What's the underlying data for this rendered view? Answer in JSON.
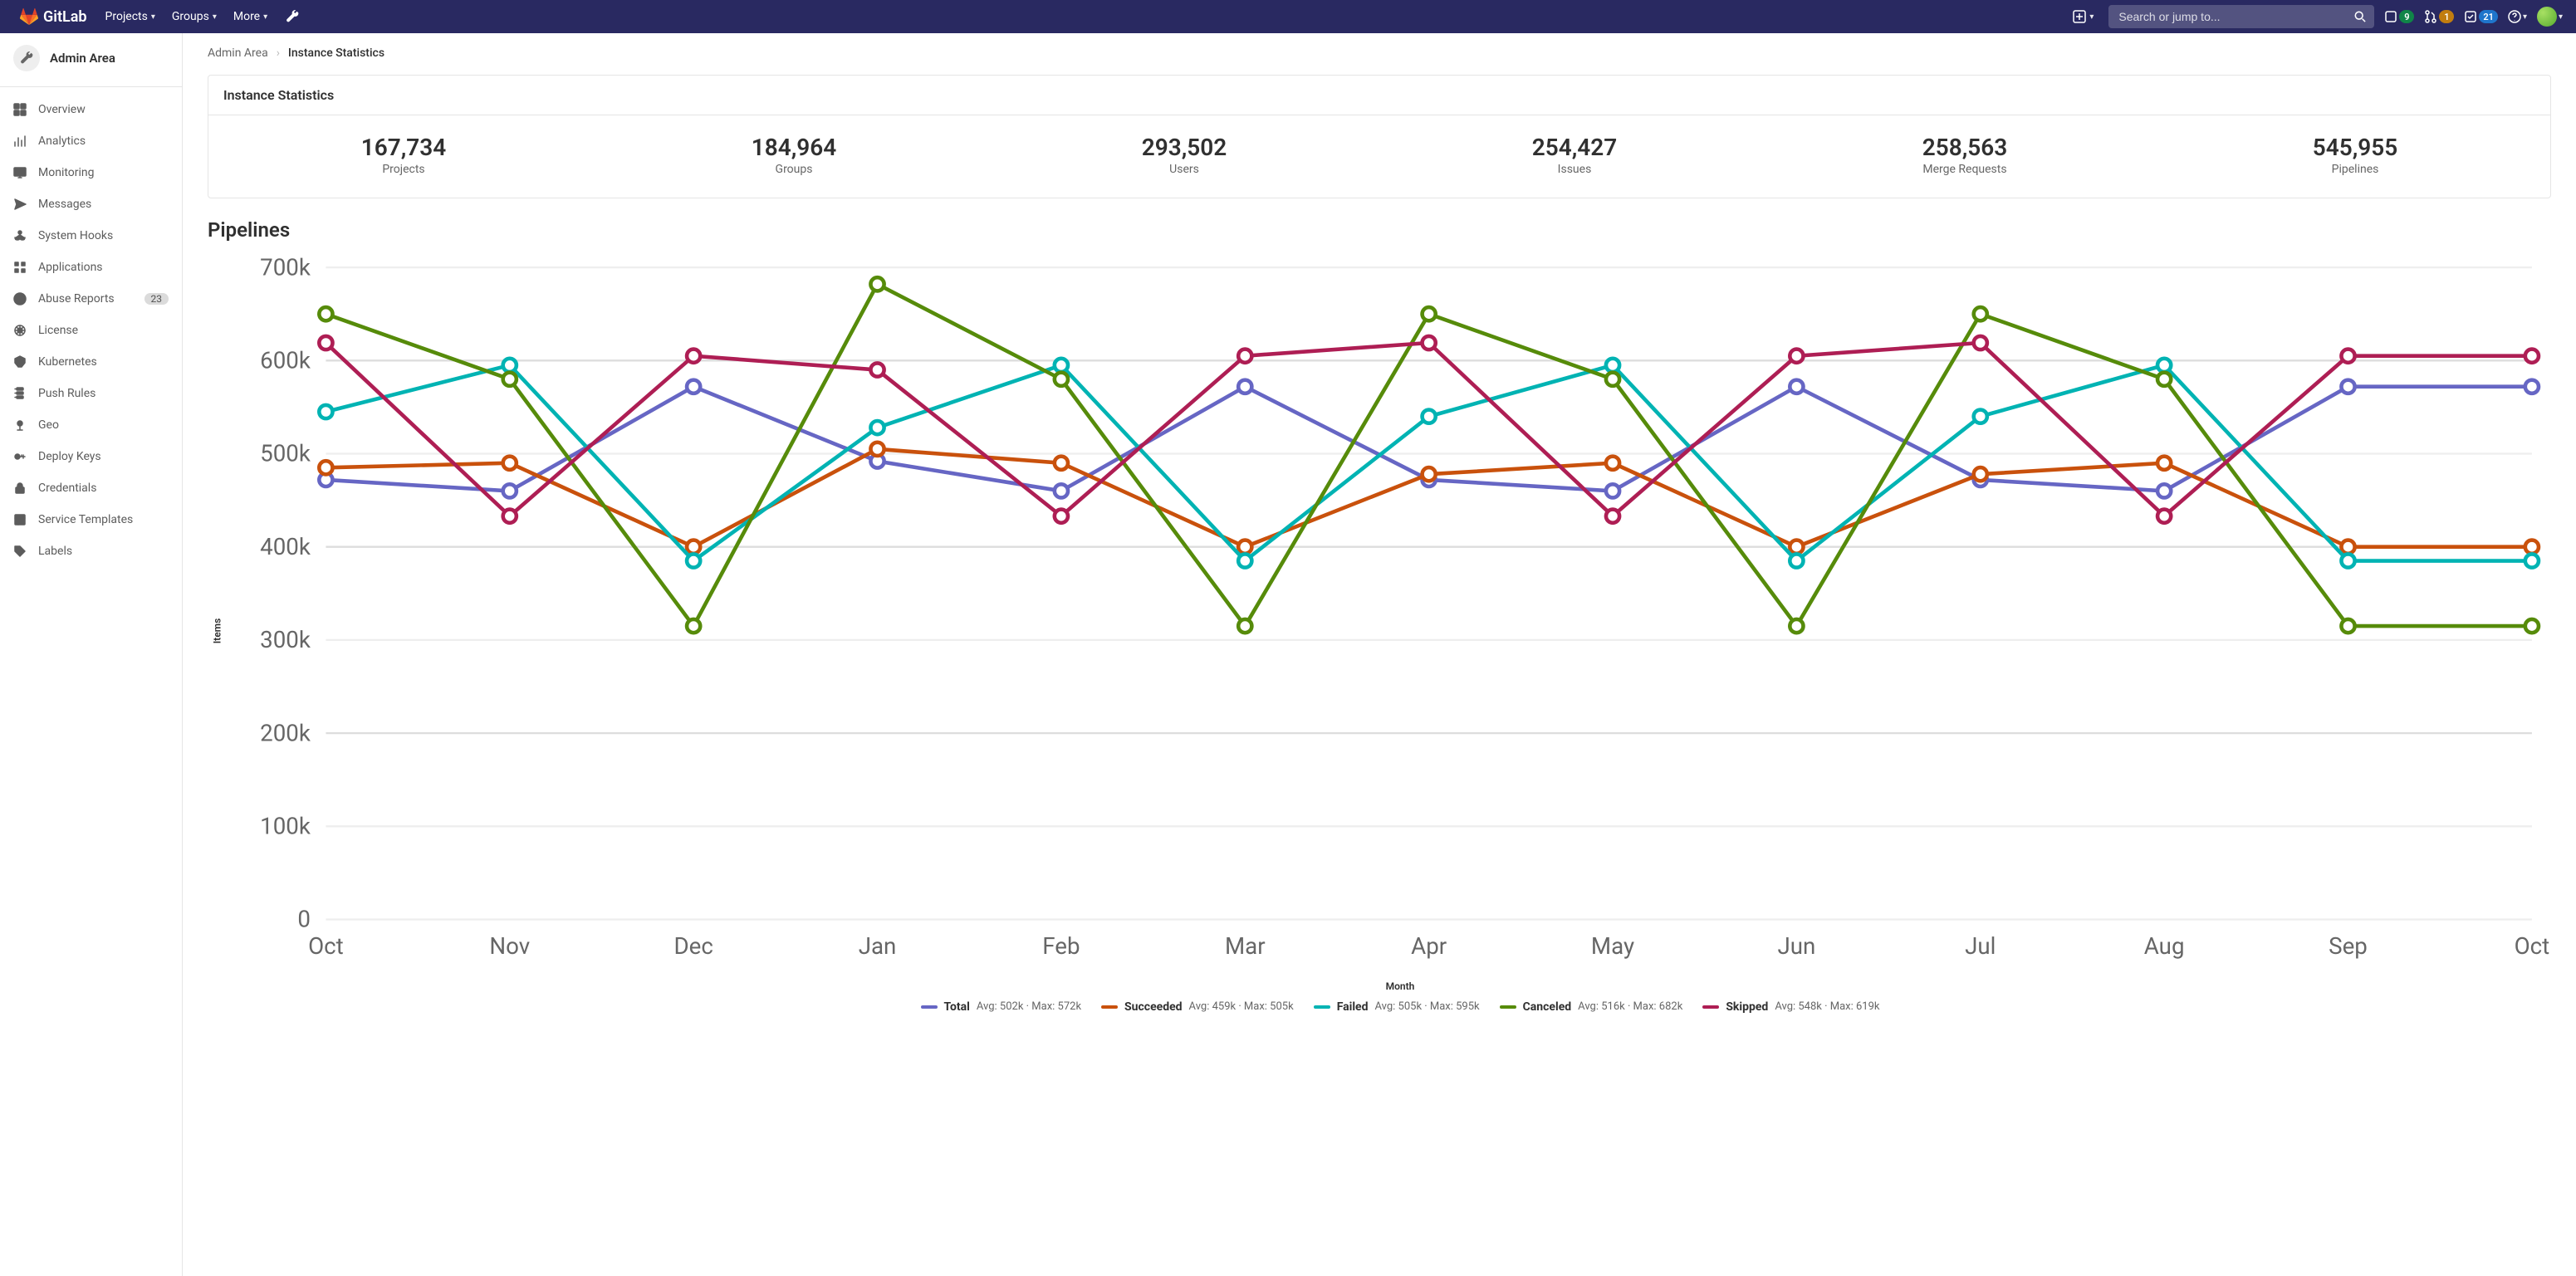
{
  "topnav": {
    "logo_text": "GitLab",
    "items": [
      {
        "label": "Projects",
        "has_caret": true
      },
      {
        "label": "Groups",
        "has_caret": true
      },
      {
        "label": "More",
        "has_caret": true
      }
    ],
    "search_placeholder": "Search or jump to...",
    "badges": {
      "issues": "9",
      "mrs": "1",
      "todos": "21"
    }
  },
  "sidebar": {
    "title": "Admin Area",
    "items": [
      {
        "icon": "overview",
        "label": "Overview"
      },
      {
        "icon": "analytics",
        "label": "Analytics"
      },
      {
        "icon": "monitoring",
        "label": "Monitoring"
      },
      {
        "icon": "messages",
        "label": "Messages"
      },
      {
        "icon": "hooks",
        "label": "System Hooks"
      },
      {
        "icon": "apps",
        "label": "Applications"
      },
      {
        "icon": "abuse",
        "label": "Abuse Reports",
        "count": "23"
      },
      {
        "icon": "license",
        "label": "License"
      },
      {
        "icon": "k8s",
        "label": "Kubernetes"
      },
      {
        "icon": "push",
        "label": "Push Rules"
      },
      {
        "icon": "geo",
        "label": "Geo"
      },
      {
        "icon": "keys",
        "label": "Deploy Keys"
      },
      {
        "icon": "creds",
        "label": "Credentials"
      },
      {
        "icon": "templates",
        "label": "Service Templates"
      },
      {
        "icon": "labels",
        "label": "Labels"
      }
    ]
  },
  "breadcrumb": {
    "parent": "Admin Area",
    "current": "Instance Statistics"
  },
  "stats_card": {
    "title": "Instance Statistics",
    "stats": [
      {
        "value": "167,734",
        "label": "Projects"
      },
      {
        "value": "184,964",
        "label": "Groups"
      },
      {
        "value": "293,502",
        "label": "Users"
      },
      {
        "value": "254,427",
        "label": "Issues"
      },
      {
        "value": "258,563",
        "label": "Merge Requests"
      },
      {
        "value": "545,955",
        "label": "Pipelines"
      }
    ]
  },
  "chart_section_title": "Pipelines",
  "chart_data": {
    "type": "line",
    "title": "Pipelines",
    "xlabel": "Month",
    "ylabel": "Items",
    "ylim": [
      0,
      700000
    ],
    "y_ticks": [
      0,
      100000,
      200000,
      300000,
      400000,
      500000,
      600000,
      700000
    ],
    "y_tick_labels": [
      "0",
      "100k",
      "200k",
      "300k",
      "400k",
      "500k",
      "600k",
      "700k"
    ],
    "categories": [
      "Oct",
      "Nov",
      "Dec",
      "Jan",
      "Feb",
      "Mar",
      "Apr",
      "May",
      "Jun",
      "Jul",
      "Aug",
      "Sep",
      "Oct"
    ],
    "series": [
      {
        "name": "Total",
        "color": "#6666c4",
        "values": [
          472000,
          460000,
          572000,
          492000,
          460000,
          572000,
          472000,
          460000,
          572000,
          472000,
          460000,
          572000,
          572000
        ],
        "stats": "Avg: 502k · Max: 572k"
      },
      {
        "name": "Succeeded",
        "color": "#c9510c",
        "values": [
          485000,
          490000,
          400000,
          505000,
          490000,
          400000,
          478000,
          490000,
          400000,
          478000,
          490000,
          400000,
          400000
        ],
        "stats": "Avg: 459k · Max: 505k"
      },
      {
        "name": "Failed",
        "color": "#00b3b3",
        "values": [
          545000,
          595000,
          385000,
          528000,
          595000,
          385000,
          540000,
          595000,
          385000,
          540000,
          595000,
          385000,
          385000
        ],
        "stats": "Avg: 505k · Max: 595k"
      },
      {
        "name": "Canceled",
        "color": "#568b0a",
        "values": [
          650000,
          580000,
          315000,
          682000,
          580000,
          315000,
          650000,
          580000,
          315000,
          650000,
          580000,
          315000,
          315000
        ],
        "stats": "Avg: 516k · Max: 682k"
      },
      {
        "name": "Skipped",
        "color": "#ae1e54",
        "values": [
          619000,
          433000,
          605000,
          590000,
          433000,
          605000,
          619000,
          433000,
          605000,
          619000,
          433000,
          605000,
          605000
        ],
        "stats": "Avg: 548k · Max: 619k"
      }
    ]
  }
}
